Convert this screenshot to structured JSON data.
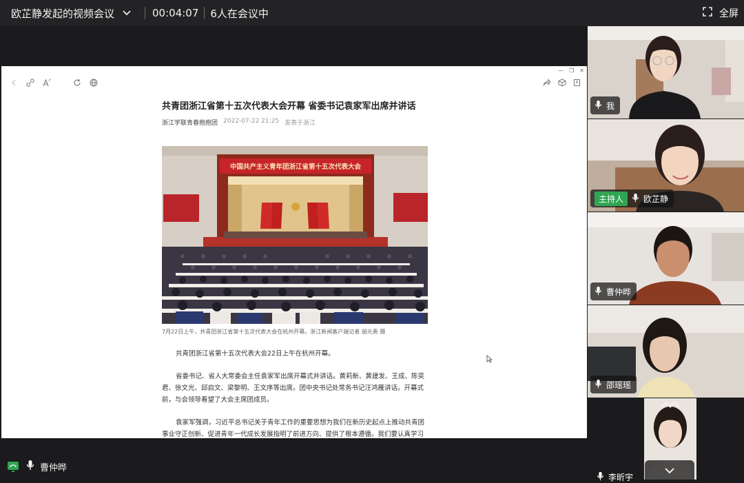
{
  "meeting": {
    "title": "欧芷静发起的视频会议",
    "elapsed": "00:04:07",
    "participant_count_text": "6人在会议中",
    "fullscreen_label": "全屏"
  },
  "article": {
    "headline": "共青团浙江省第十五次代表大会开幕 省委书记袁家军出席并讲话",
    "author": "浙江学联青春抱抱团",
    "datetime": "2022-07-22 21:25",
    "location": "发表于浙江",
    "banner_text": "中国共产主义青年团浙江省第十五次代表大会",
    "caption": "7月22日上午，共青团浙江省第十五次代表大会在杭州开幕。浙江新闻客户端记者 胡元勇 摄",
    "paragraphs": [
      "共青团浙江省第十五次代表大会22日上午在杭州开幕。",
      "省委书记、省人大常委会主任袁家军出席开幕式并讲话。黄莉新、黄建发、王成、陈奕君、徐文光、邱启文、梁黎明、王文序等出席。团中央书记处常务书记汪鸿雁讲话。开幕式前，与会领导看望了大会主席团成员。",
      "袁家军强调，习近平总书记关于青年工作的重要思想为我们在新历史起点上推动共青团事业守正创新、促进青年一代成长发展指明了前进方向、提供了根本遵循。我们要认真学习"
    ]
  },
  "bottom": {
    "speaker_name": "曹仲晔"
  },
  "participants": [
    {
      "name": "我",
      "host": false
    },
    {
      "name": "欧芷静",
      "host": true,
      "host_label": "主持人"
    },
    {
      "name": "曹仲晔",
      "host": false
    },
    {
      "name": "邵瑶瑶",
      "host": false
    },
    {
      "name": "李昕宇",
      "host": false
    }
  ],
  "colors": {
    "host_badge": "#2fa551",
    "bar_bg": "#232325"
  }
}
